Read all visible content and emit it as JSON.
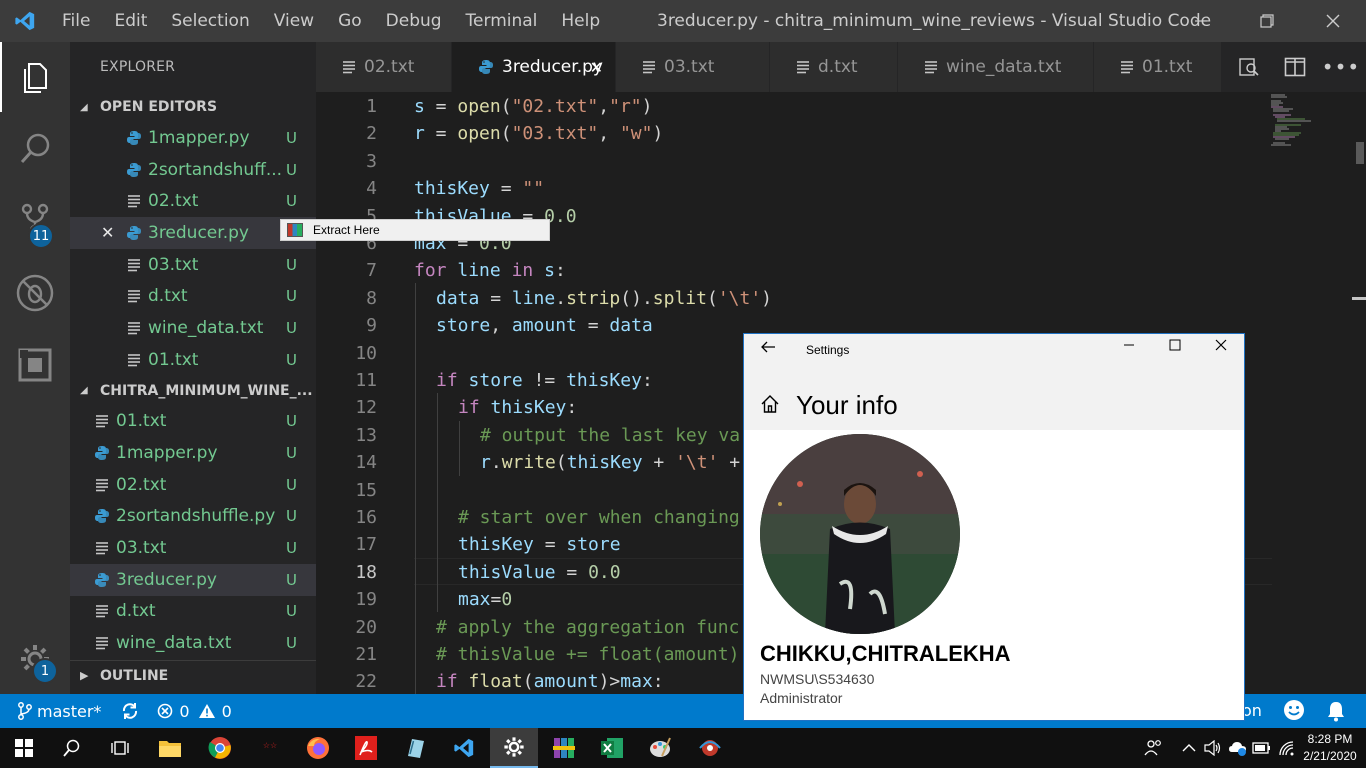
{
  "titlebar": {
    "menu": [
      "File",
      "Edit",
      "Selection",
      "View",
      "Go",
      "Debug",
      "Terminal",
      "Help"
    ],
    "title": "3reducer.py - chitra_minimum_wine_reviews - Visual Studio Code"
  },
  "activity": {
    "scm_badge": "11",
    "settings_badge": "1"
  },
  "sidebar": {
    "title": "EXPLORER",
    "open_editors_header": "OPEN EDITORS",
    "open_editors": [
      {
        "name": "1mapper.py",
        "status": "U",
        "type": "python"
      },
      {
        "name": "2sortandshuff...",
        "status": "U",
        "type": "python"
      },
      {
        "name": "02.txt",
        "status": "U",
        "type": "text"
      },
      {
        "name": "3reducer.py",
        "status": "U",
        "type": "python"
      },
      {
        "name": "03.txt",
        "status": "U",
        "type": "text"
      },
      {
        "name": "d.txt",
        "status": "U",
        "type": "text"
      },
      {
        "name": "wine_data.txt",
        "status": "U",
        "type": "text"
      },
      {
        "name": "01.txt",
        "status": "U",
        "type": "text"
      }
    ],
    "folder_header": "CHITRA_MINIMUM_WINE_...",
    "folder_files": [
      {
        "name": "01.txt",
        "status": "U",
        "type": "text"
      },
      {
        "name": "1mapper.py",
        "status": "U",
        "type": "python"
      },
      {
        "name": "02.txt",
        "status": "U",
        "type": "text"
      },
      {
        "name": "2sortandshuffle.py",
        "status": "U",
        "type": "python"
      },
      {
        "name": "03.txt",
        "status": "U",
        "type": "text"
      },
      {
        "name": "3reducer.py",
        "status": "U",
        "type": "python"
      },
      {
        "name": "d.txt",
        "status": "U",
        "type": "text"
      },
      {
        "name": "wine_data.txt",
        "status": "U",
        "type": "text"
      }
    ],
    "outline_header": "OUTLINE"
  },
  "context_menu": {
    "label": "Extract Here"
  },
  "tabs": [
    {
      "label": "02.txt",
      "type": "text",
      "active": false
    },
    {
      "label": "3reducer.py",
      "type": "python",
      "active": true
    },
    {
      "label": "03.txt",
      "type": "text",
      "active": false
    },
    {
      "label": "d.txt",
      "type": "text",
      "active": false
    },
    {
      "label": "wine_data.txt",
      "type": "text",
      "active": false
    },
    {
      "label": "01.txt",
      "type": "text",
      "active": false
    }
  ],
  "editor": {
    "current_line": 18,
    "lines": [
      {
        "n": "1",
        "indent": 0,
        "tokens": [
          [
            "var",
            "s"
          ],
          [
            "op",
            " = "
          ],
          [
            "fn",
            "open"
          ],
          [
            "op",
            "("
          ],
          [
            "str",
            "\"02.txt\""
          ],
          [
            "op",
            ","
          ],
          [
            "str",
            "\"r\""
          ],
          [
            "op",
            ")"
          ]
        ]
      },
      {
        "n": "2",
        "indent": 0,
        "tokens": [
          [
            "var",
            "r"
          ],
          [
            "op",
            " = "
          ],
          [
            "fn",
            "open"
          ],
          [
            "op",
            "("
          ],
          [
            "str",
            "\"03.txt\""
          ],
          [
            "op",
            ", "
          ],
          [
            "str",
            "\"w\""
          ],
          [
            "op",
            ")"
          ]
        ]
      },
      {
        "n": "3",
        "indent": 0,
        "tokens": []
      },
      {
        "n": "4",
        "indent": 0,
        "tokens": [
          [
            "var",
            "thisKey"
          ],
          [
            "op",
            " = "
          ],
          [
            "str",
            "\"\""
          ]
        ]
      },
      {
        "n": "5",
        "indent": 0,
        "tokens": [
          [
            "var",
            "thisValue"
          ],
          [
            "op",
            " = "
          ],
          [
            "num",
            "0.0"
          ]
        ]
      },
      {
        "n": "6",
        "indent": 0,
        "tokens": [
          [
            "var",
            "max"
          ],
          [
            "op",
            " = "
          ],
          [
            "num",
            "0.0"
          ]
        ]
      },
      {
        "n": "7",
        "indent": 0,
        "tokens": [
          [
            "kw",
            "for"
          ],
          [
            "op",
            " "
          ],
          [
            "var",
            "line"
          ],
          [
            "op",
            " "
          ],
          [
            "kw",
            "in"
          ],
          [
            "op",
            " "
          ],
          [
            "var",
            "s"
          ],
          [
            "op",
            ":"
          ]
        ]
      },
      {
        "n": "8",
        "indent": 1,
        "tokens": [
          [
            "var",
            "data"
          ],
          [
            "op",
            " = "
          ],
          [
            "var",
            "line"
          ],
          [
            "op",
            "."
          ],
          [
            "fn",
            "strip"
          ],
          [
            "op",
            "()."
          ],
          [
            "fn",
            "split"
          ],
          [
            "op",
            "("
          ],
          [
            "str",
            "'\\t'"
          ],
          [
            "op",
            ")"
          ]
        ]
      },
      {
        "n": "9",
        "indent": 1,
        "tokens": [
          [
            "var",
            "store"
          ],
          [
            "op",
            ", "
          ],
          [
            "var",
            "amount"
          ],
          [
            "op",
            " = "
          ],
          [
            "var",
            "data"
          ]
        ]
      },
      {
        "n": "10",
        "indent": 1,
        "tokens": []
      },
      {
        "n": "11",
        "indent": 1,
        "tokens": [
          [
            "kw",
            "if"
          ],
          [
            "op",
            " "
          ],
          [
            "var",
            "store"
          ],
          [
            "op",
            " != "
          ],
          [
            "var",
            "thisKey"
          ],
          [
            "op",
            ":"
          ]
        ]
      },
      {
        "n": "12",
        "indent": 2,
        "tokens": [
          [
            "kw",
            "if"
          ],
          [
            "op",
            " "
          ],
          [
            "var",
            "thisKey"
          ],
          [
            "op",
            ":"
          ]
        ]
      },
      {
        "n": "13",
        "indent": 3,
        "tokens": [
          [
            "cm",
            "# output the last key va"
          ]
        ]
      },
      {
        "n": "14",
        "indent": 3,
        "tokens": [
          [
            "var",
            "r"
          ],
          [
            "op",
            "."
          ],
          [
            "fn",
            "write"
          ],
          [
            "op",
            "("
          ],
          [
            "var",
            "thisKey"
          ],
          [
            "op",
            " + "
          ],
          [
            "str",
            "'\\t'"
          ],
          [
            "op",
            " +"
          ]
        ]
      },
      {
        "n": "15",
        "indent": 2,
        "tokens": []
      },
      {
        "n": "16",
        "indent": 2,
        "tokens": [
          [
            "cm",
            "# start over when changing"
          ]
        ]
      },
      {
        "n": "17",
        "indent": 2,
        "tokens": [
          [
            "var",
            "thisKey"
          ],
          [
            "op",
            " = "
          ],
          [
            "var",
            "store"
          ]
        ]
      },
      {
        "n": "18",
        "indent": 2,
        "tokens": [
          [
            "var",
            "thisValue"
          ],
          [
            "op",
            " = "
          ],
          [
            "num",
            "0.0"
          ]
        ]
      },
      {
        "n": "19",
        "indent": 2,
        "tokens": [
          [
            "var",
            "max"
          ],
          [
            "op",
            "="
          ],
          [
            "num",
            "0"
          ]
        ]
      },
      {
        "n": "20",
        "indent": 1,
        "tokens": [
          [
            "cm",
            "# apply the aggregation func"
          ]
        ]
      },
      {
        "n": "21",
        "indent": 1,
        "tokens": [
          [
            "cm",
            "# thisValue += float(amount)"
          ]
        ]
      },
      {
        "n": "22",
        "indent": 1,
        "tokens": [
          [
            "kw",
            "if"
          ],
          [
            "op",
            " "
          ],
          [
            "fn",
            "float"
          ],
          [
            "op",
            "("
          ],
          [
            "var",
            "amount"
          ],
          [
            "op",
            ")>"
          ],
          [
            "var",
            "max"
          ],
          [
            "op",
            ":"
          ]
        ]
      }
    ]
  },
  "statusbar": {
    "branch": "master*",
    "errors": "0",
    "warnings": "0",
    "right_text": "on"
  },
  "settings_window": {
    "title": "Settings",
    "page_title": "Your info",
    "user_name": "CHIKKU,CHITRALEKHA",
    "account": "NWMSU\\S534630",
    "role": "Administrator"
  },
  "taskbar": {
    "time": "8:28 PM",
    "date": "2/21/2020"
  },
  "colors": {
    "accent": "#007acc",
    "untracked": "#73c991",
    "python_icon": "#3b9bd2"
  }
}
